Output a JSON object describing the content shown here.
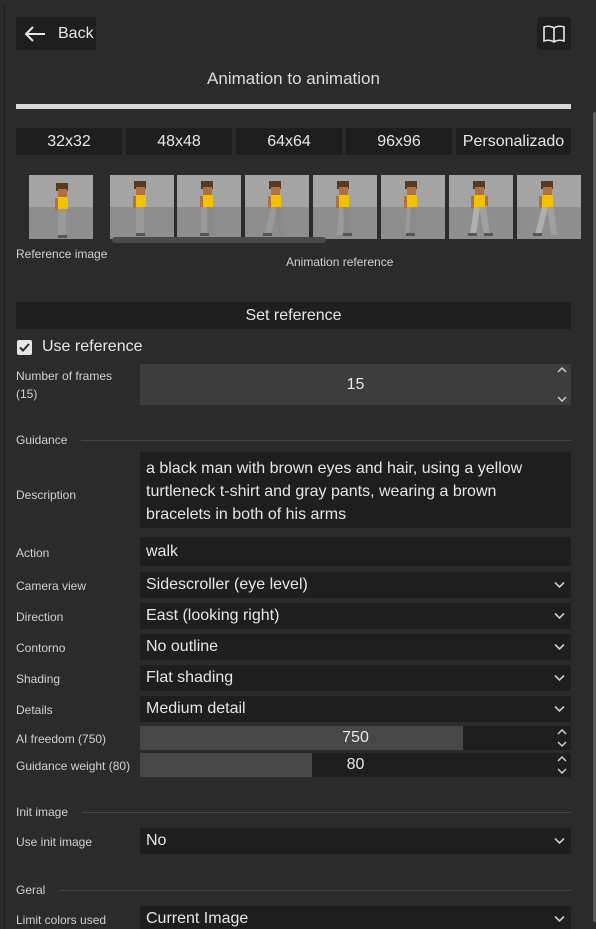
{
  "header": {
    "back_label": "Back",
    "title": "Animation to animation"
  },
  "sizes": [
    "32x32",
    "48x48",
    "64x64",
    "96x96",
    "Personalizado"
  ],
  "reference": {
    "reference_image_label": "Reference image",
    "animation_reference_label": "Animation reference",
    "set_reference_label": "Set reference",
    "use_reference_label": "Use reference",
    "use_reference_checked": true
  },
  "frames": {
    "label": "Number of frames (15)",
    "value": "15"
  },
  "guidance": {
    "section_label": "Guidance",
    "description_label": "Description",
    "description_value": "a black man with brown eyes and hair, using a yellow turtleneck t-shirt and gray pants, wearing a brown bracelets in both of his arms",
    "action_label": "Action",
    "action_value": "walk",
    "camera_label": "Camera view",
    "camera_value": "Sidescroller (eye level)",
    "direction_label": "Direction",
    "direction_value": "East (looking right)",
    "outline_label": "Contorno",
    "outline_value": "No outline",
    "shading_label": "Shading",
    "shading_value": "Flat shading",
    "details_label": "Details",
    "details_value": "Medium detail",
    "ai_freedom_label": "AI freedom (750)",
    "ai_freedom_value": "750",
    "ai_freedom_fraction": 0.75,
    "guidance_weight_label": "Guidance weight (80)",
    "guidance_weight_value": "80",
    "guidance_weight_fraction": 0.4
  },
  "init_image": {
    "section_label": "Init image",
    "use_init_label": "Use init image",
    "use_init_value": "No"
  },
  "general": {
    "section_label": "Geral",
    "limit_colors_label": "Limit colors used",
    "limit_colors_value": "Current Image"
  },
  "icons": {
    "back": "arrow-left-icon",
    "book": "book-icon",
    "check": "check-icon",
    "chevron": "chevron-down-icon",
    "spinner": "spinner-arrows-icon"
  },
  "colors": {
    "background": "#2b2b2b",
    "field": "#1e1e1e",
    "text": "#e6e6e6",
    "shirt": "#f2c200",
    "skin": "#b07040"
  }
}
